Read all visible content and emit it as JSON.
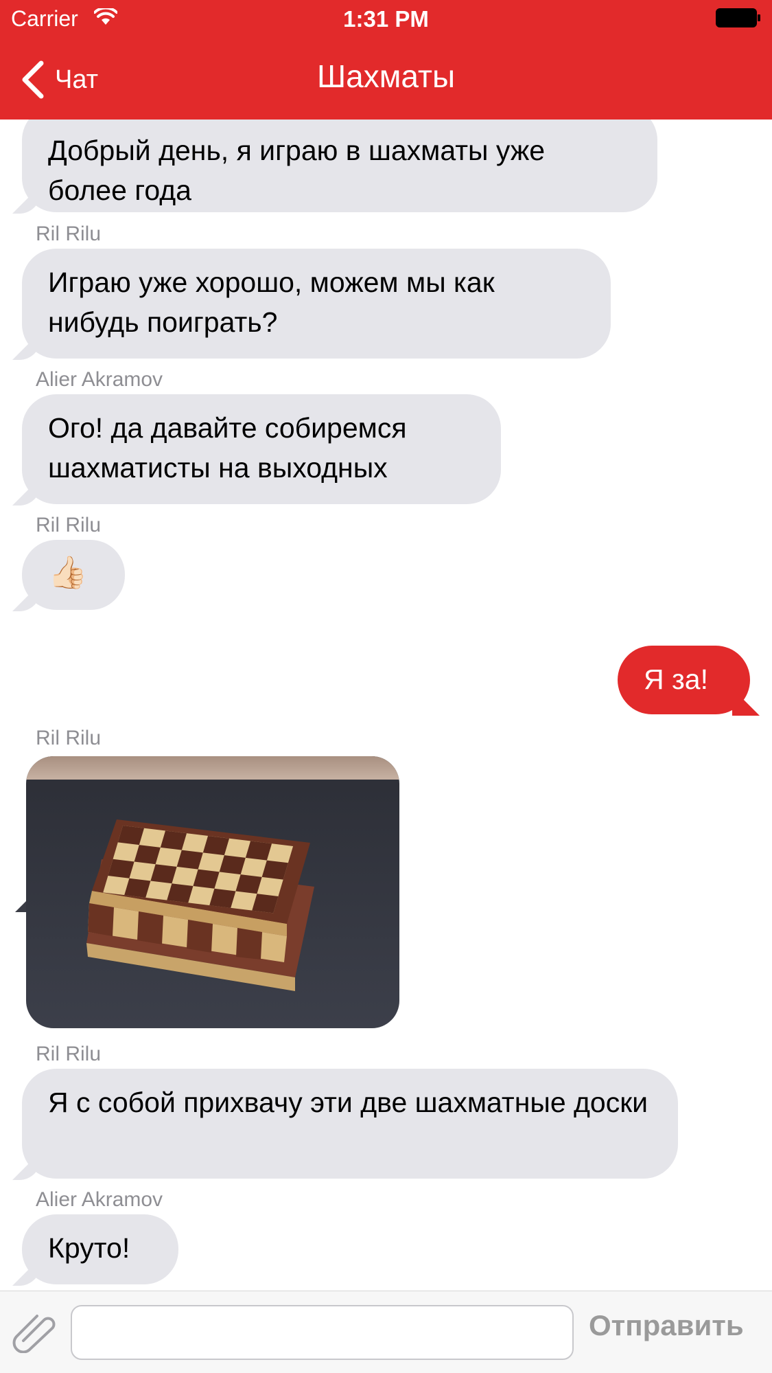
{
  "status_bar": {
    "carrier": "Carrier",
    "time": "1:31 PM"
  },
  "nav": {
    "back_label": "Чат",
    "title": "Шахматы"
  },
  "colors": {
    "brand": "#e22a2b",
    "incoming_bubble": "#e5e5ea",
    "sender_label": "#8e8e93"
  },
  "messages": [
    {
      "type": "incoming",
      "sender": "",
      "text": "Добрый день, я играю в шахматы уже более года"
    },
    {
      "type": "incoming",
      "sender": "Ril  Rilu",
      "text": "Играю уже хорошо, можем мы как нибудь поиграть?"
    },
    {
      "type": "incoming",
      "sender": "Alier Akramov",
      "text": "Ого! да давайте собиремся шахматисты на выходных"
    },
    {
      "type": "incoming",
      "sender": "Ril  Rilu",
      "text": "👍🏻"
    },
    {
      "type": "outgoing",
      "sender": "",
      "text": "Я за!"
    },
    {
      "type": "photo",
      "sender": "Ril Rilu",
      "text": ""
    },
    {
      "type": "incoming",
      "sender": "Ril  Rilu",
      "text": "Я с собой прихвачу эти две шахматные доски"
    },
    {
      "type": "incoming",
      "sender": "Alier Akramov",
      "text": "Круто!"
    }
  ],
  "input": {
    "value": "",
    "placeholder": "",
    "send_label": "Отправить"
  }
}
